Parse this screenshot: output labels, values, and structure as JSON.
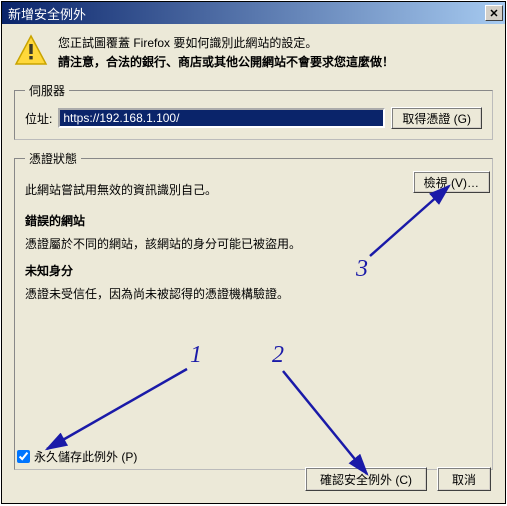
{
  "title": "新增安全例外",
  "warning": {
    "line1": "您正試圖覆蓋 Firefox 要如何識別此網站的設定。",
    "line2": "請注意，合法的銀行、商店或其他公開網站不會要求您這麼做！"
  },
  "server": {
    "legend": "伺服器",
    "address_label": "位址:",
    "address_value": "https://192.168.1.100/",
    "get_cert_label": "取得憑證 (G)"
  },
  "status": {
    "legend": "憑證狀態",
    "intro": "此網站嘗試用無效的資訊識別自己。",
    "view_label": "檢視 (V)…",
    "wrong_site_title": "錯誤的網站",
    "wrong_site_text": "憑證屬於不同的網站，該網站的身分可能已被盜用。",
    "unknown_title": "未知身分",
    "unknown_text": "憑證未受信任，因為尚未被認得的憑證機構驗證。",
    "perm_store_label": "永久儲存此例外 (P)"
  },
  "buttons": {
    "confirm": "確認安全例外 (C)",
    "cancel": "取消"
  },
  "annotations": {
    "n1": "1",
    "n2": "2",
    "n3": "3"
  }
}
